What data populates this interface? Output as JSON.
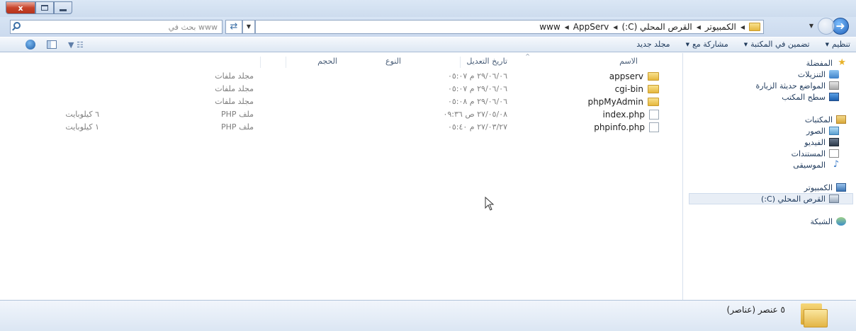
{
  "window": {
    "caption": {
      "close": "x",
      "maximize": "",
      "minimize": ""
    }
  },
  "address": {
    "breadcrumbs": [
      "الكمبيوتر",
      "القرص المحلي (C:)",
      "AppServ",
      "www"
    ],
    "search_placeholder": "بحث في www"
  },
  "toolbar": {
    "organize": "تنظيم",
    "include_in_library": "تضمين في المكتبة",
    "share_with": "مشاركة مع",
    "new_folder": "مجلد جديد"
  },
  "sidebar": {
    "favorites": {
      "label": "المفضلة",
      "items": [
        "التنزيلات",
        "المواضع حديثة الزيارة",
        "سطح المكتب"
      ]
    },
    "libraries": {
      "label": "المكتبات",
      "items": [
        "الصور",
        "الفيديو",
        "المستندات",
        "الموسيقى"
      ]
    },
    "computer": {
      "label": "الكمبيوتر",
      "items": [
        "القرص المحلي (C:)"
      ]
    },
    "network": {
      "label": "الشبكة"
    }
  },
  "columns": {
    "name": "الاسم",
    "modified": "تاريخ التعديل",
    "type": "النوع",
    "size": "الحجم"
  },
  "files": [
    {
      "name": "appserv",
      "modified": "٢٩/٠٦/٠٦ م ٠٥:٠٧",
      "type": "مجلد ملفات",
      "size": "",
      "kind": "folder"
    },
    {
      "name": "cgi-bin",
      "modified": "٢٩/٠٦/٠٦ م ٠٥:٠٧",
      "type": "مجلد ملفات",
      "size": "",
      "kind": "folder"
    },
    {
      "name": "phpMyAdmin",
      "modified": "٢٩/٠٦/٠٦ م ٠٥:٠٨",
      "type": "مجلد ملفات",
      "size": "",
      "kind": "folder"
    },
    {
      "name": "index.php",
      "modified": "٢٧/٠٥/٠٨ ص ٠٩:٣٦",
      "type": "ملف PHP",
      "size": "٦ كيلوبايت",
      "kind": "file"
    },
    {
      "name": "phpinfo.php",
      "modified": "٢٧/٠٣/٢٧ م ٠٥:٤٠",
      "type": "ملف PHP",
      "size": "١ كيلوبايت",
      "kind": "file"
    }
  ],
  "status": {
    "count": "٥ عنصر (عناصر)"
  },
  "colors": {
    "accent": "#1e395b",
    "selection": "#e8eef6"
  }
}
